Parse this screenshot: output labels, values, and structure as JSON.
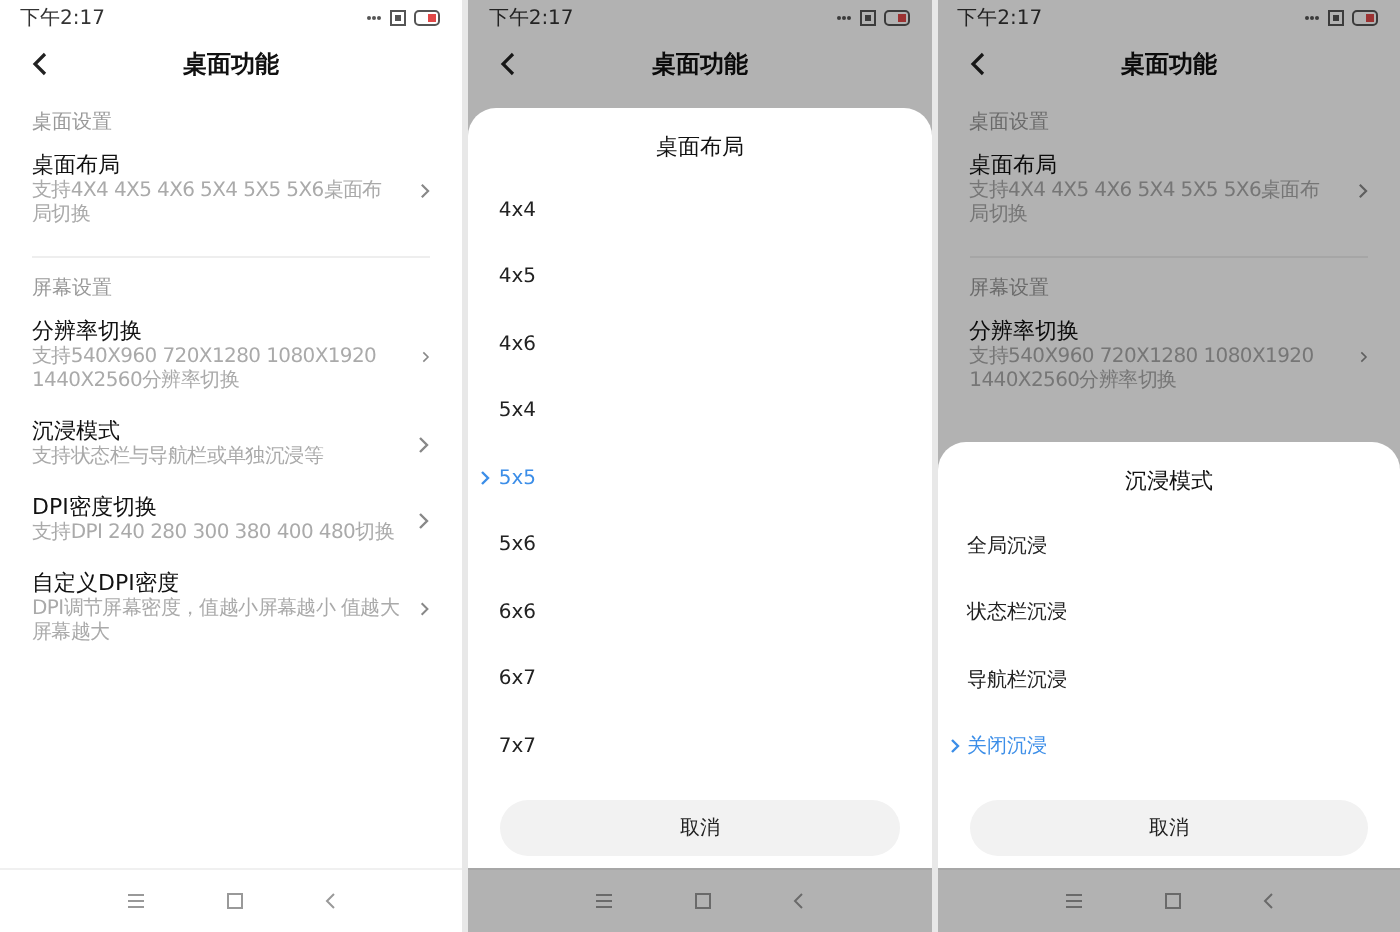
{
  "screens": [
    {
      "status": {
        "time": "下午2:17"
      },
      "title": "桌面功能",
      "dimmed": false,
      "sections": [
        {
          "label": "桌面设置",
          "items": [
            {
              "title": "桌面布局",
              "subtitle": "支持4X4 4X5 4X6 5X4 5X5 5X6桌面布局切换"
            }
          ]
        },
        {
          "label": "屏幕设置",
          "items": [
            {
              "title": "分辨率切换",
              "subtitle": "支持540X960 720X1280 1080X1920 1440X2560分辨率切换"
            },
            {
              "title": "沉浸模式",
              "subtitle": "支持状态栏与导航栏或单独沉浸等"
            },
            {
              "title": "DPI密度切换",
              "subtitle": "支持DPI 240 280 300 380 400 480切换"
            },
            {
              "title": "自定义DPI密度",
              "subtitle": "DPI调节屏幕密度，值越小屏幕越小 值越大屏幕越大"
            }
          ]
        }
      ]
    },
    {
      "status": {
        "time": "下午2:17"
      },
      "title": "桌面功能",
      "dimmed": true,
      "sheet": {
        "title": "桌面布局",
        "options": [
          {
            "label": "4x4",
            "selected": false
          },
          {
            "label": "4x5",
            "selected": false
          },
          {
            "label": "4x6",
            "selected": false
          },
          {
            "label": "5x4",
            "selected": false
          },
          {
            "label": "5x5",
            "selected": true
          },
          {
            "label": "5x6",
            "selected": false
          },
          {
            "label": "6x6",
            "selected": false
          },
          {
            "label": "6x7",
            "selected": false
          },
          {
            "label": "7x7",
            "selected": false
          }
        ],
        "cancel": "取消"
      }
    },
    {
      "status": {
        "time": "下午2:17"
      },
      "title": "桌面功能",
      "dimmed": true,
      "sections": [
        {
          "label": "桌面设置",
          "items": [
            {
              "title": "桌面布局",
              "subtitle": "支持4X4 4X5 4X6 5X4 5X5 5X6桌面布局切换"
            }
          ]
        },
        {
          "label": "屏幕设置",
          "items": [
            {
              "title": "分辨率切换",
              "subtitle": "支持540X960 720X1280 1080X1920 1440X2560分辨率切换"
            }
          ]
        }
      ],
      "sheet": {
        "title": "沉浸模式",
        "options": [
          {
            "label": "全局沉浸",
            "selected": false
          },
          {
            "label": "状态栏沉浸",
            "selected": false
          },
          {
            "label": "导航栏沉浸",
            "selected": false
          },
          {
            "label": "关闭沉浸",
            "selected": true
          }
        ],
        "cancel": "取消"
      }
    }
  ]
}
